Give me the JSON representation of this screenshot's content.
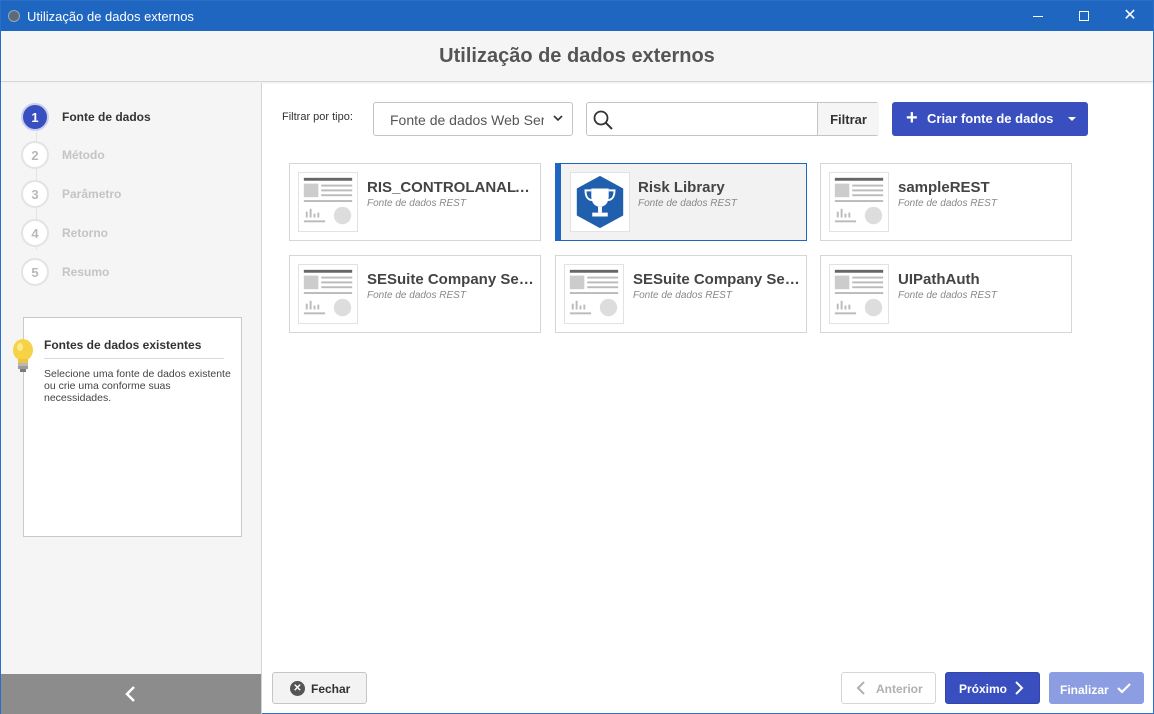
{
  "window": {
    "title": "Utilização de dados externos"
  },
  "header": {
    "title": "Utilização de dados externos"
  },
  "steps": [
    {
      "num": "1",
      "label": "Fonte de dados",
      "active": true
    },
    {
      "num": "2",
      "label": "Método",
      "active": false
    },
    {
      "num": "3",
      "label": "Parâmetro",
      "active": false
    },
    {
      "num": "4",
      "label": "Retorno",
      "active": false
    },
    {
      "num": "5",
      "label": "Resumo",
      "active": false
    }
  ],
  "tip": {
    "title": "Fontes de dados existentes",
    "text": "Selecione uma fonte de dados existente ou crie uma conforme suas necessidades."
  },
  "toolbar": {
    "filter_label": "Filtrar por tipo:",
    "filter_value": "Fonte de dados Web Service",
    "search_placeholder": "",
    "filter_button": "Filtrar",
    "create_button": "Criar fonte de dados"
  },
  "cards": [
    {
      "name": "RIS_CONTROLANALYSIS",
      "type": "Fonte de dados REST",
      "icon": "document-thumbnail-icon",
      "selected": false
    },
    {
      "name": "Risk Library",
      "type": "Fonte de dados REST",
      "icon": "trophy-icon",
      "selected": true
    },
    {
      "name": "sampleREST",
      "type": "Fonte de dados REST",
      "icon": "document-thumbnail-icon",
      "selected": false
    },
    {
      "name": "SESuite Company Service",
      "type": "Fonte de dados REST",
      "icon": "document-thumbnail-icon",
      "selected": false
    },
    {
      "name": "SESuite Company Service",
      "type": "Fonte de dados REST",
      "icon": "document-thumbnail-icon",
      "selected": false
    },
    {
      "name": "UIPathAuth",
      "type": "Fonte de dados REST",
      "icon": "document-thumbnail-icon",
      "selected": false
    }
  ],
  "footer": {
    "close": "Fechar",
    "previous": "Anterior",
    "next": "Próximo",
    "finish": "Finalizar"
  },
  "colors": {
    "titlebar": "#1f66c1",
    "accent": "#3a4fbf",
    "finish_disabled": "#8d9de1"
  }
}
